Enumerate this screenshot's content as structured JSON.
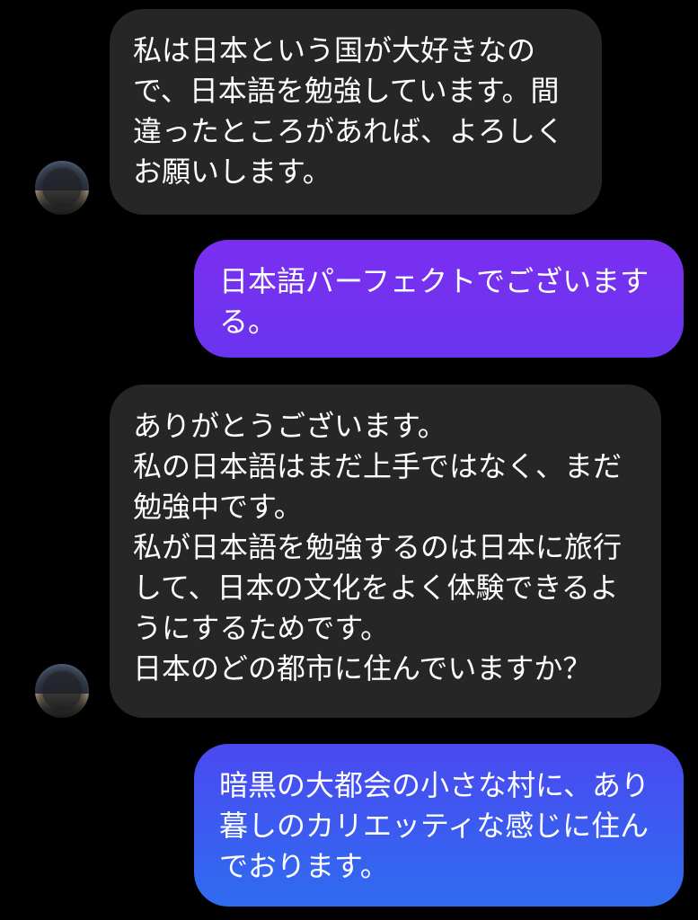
{
  "colors": {
    "background": "#000000",
    "incoming_bubble": "#262626",
    "outgoing_gradient_top": "#7b2ff0",
    "outgoing_gradient_mid": "#5540f0",
    "outgoing_gradient_bottom": "#2f6cf0"
  },
  "messages": [
    {
      "direction": "incoming",
      "text": "私は日本という国が大好きなので、日本語を勉強しています。間違ったところがあれば、よろしくお願いします。",
      "has_avatar": true,
      "avatar_icon": "profile-photo-blurred"
    },
    {
      "direction": "outgoing",
      "text": "日本語パーフェクトでございまする。"
    },
    {
      "direction": "incoming",
      "text": "ありがとうございます。\n私の日本語はまだ上手ではなく、まだ勉強中です。\n私が日本語を勉強するのは日本に旅行して、日本の文化をよく体験できるようにするためです。\n日本のどの都市に住んでいますか？",
      "has_avatar": true,
      "avatar_icon": "profile-photo-blurred"
    },
    {
      "direction": "outgoing",
      "text": "暗黒の大都会の小さな村に、あり暮しのカリエッティな感じに住んでおります。"
    }
  ]
}
